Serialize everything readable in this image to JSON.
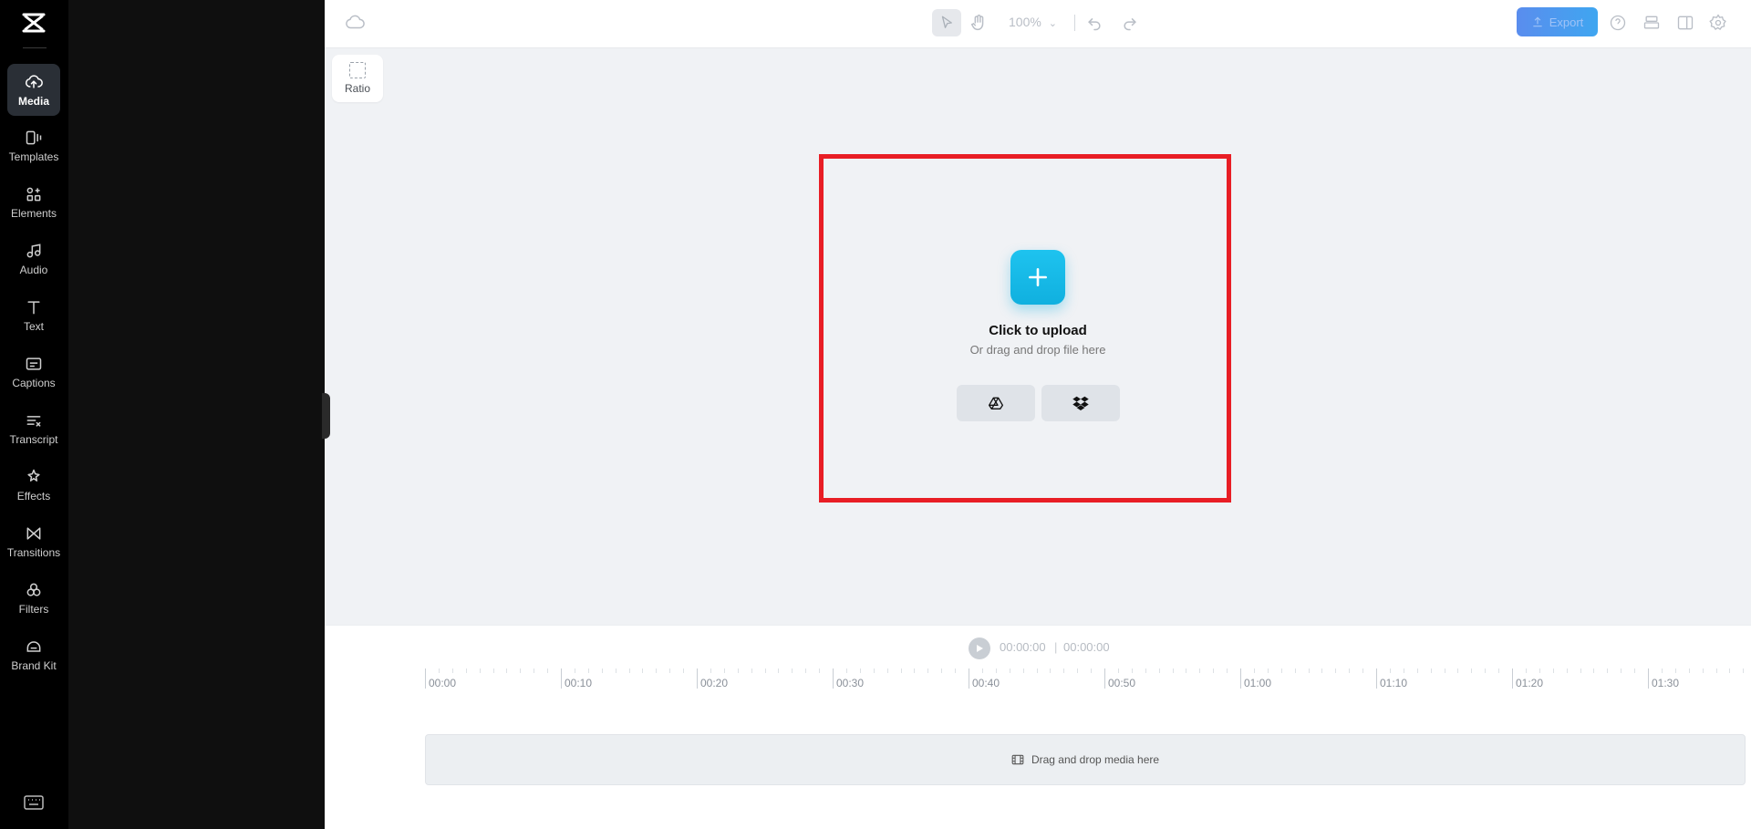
{
  "sidebar": {
    "items": [
      {
        "label": "Media",
        "icon": "cloud-upload-icon",
        "active": true
      },
      {
        "label": "Templates",
        "icon": "templates-icon",
        "active": false
      },
      {
        "label": "Elements",
        "icon": "elements-icon",
        "active": false
      },
      {
        "label": "Audio",
        "icon": "music-note-icon",
        "active": false
      },
      {
        "label": "Text",
        "icon": "text-icon",
        "active": false
      },
      {
        "label": "Captions",
        "icon": "captions-icon",
        "active": false
      },
      {
        "label": "Transcript",
        "icon": "transcript-icon",
        "active": false
      },
      {
        "label": "Effects",
        "icon": "effects-icon",
        "active": false
      },
      {
        "label": "Transitions",
        "icon": "transitions-icon",
        "active": false
      },
      {
        "label": "Filters",
        "icon": "filters-icon",
        "active": false
      },
      {
        "label": "Brand Kit",
        "icon": "brand-kit-icon",
        "active": false
      }
    ]
  },
  "toolbar": {
    "zoom": "100%",
    "export_label": "Export"
  },
  "canvas": {
    "ratio_label": "Ratio"
  },
  "upload": {
    "title": "Click to upload",
    "subtitle": "Or drag and drop file here",
    "sources": [
      "google-drive-icon",
      "dropbox-icon"
    ]
  },
  "playback": {
    "current_time": "00:00:00",
    "separator": "|",
    "total_time": "00:00:00"
  },
  "timeline": {
    "ticks": [
      "00:00",
      "00:10",
      "00:20",
      "00:30",
      "00:40",
      "00:50",
      "01:00",
      "01:10",
      "01:20",
      "01:30"
    ],
    "drop_hint": "Drag and drop media here"
  },
  "colors": {
    "accent": "#1ec3ef",
    "highlight_frame": "#e81e25",
    "export": "#4a9bef"
  }
}
